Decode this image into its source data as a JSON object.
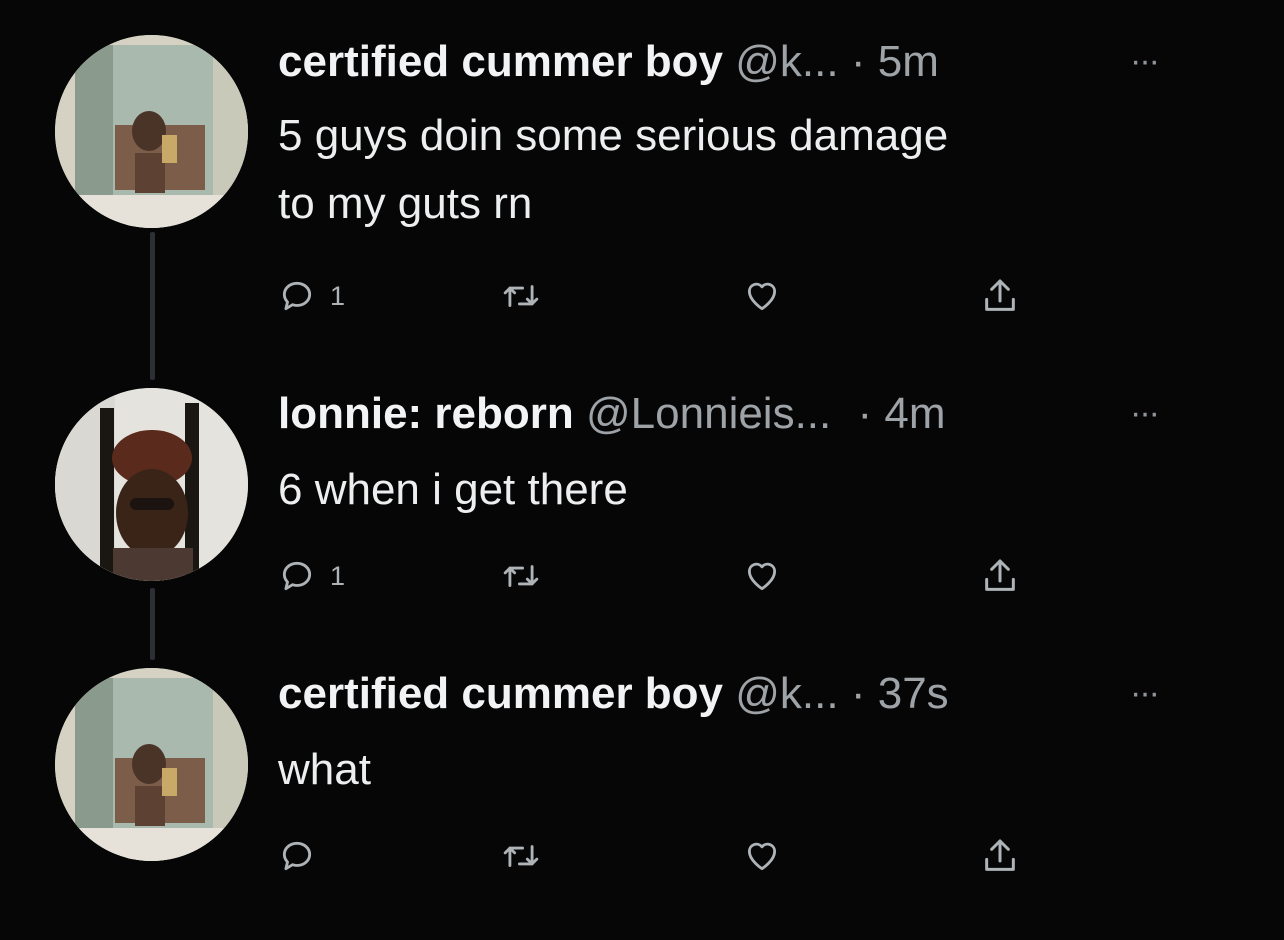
{
  "tweets": [
    {
      "name": "certified cummer boy",
      "handle": "@k...",
      "sep": "·",
      "time": "5m",
      "more": "···",
      "lines": [
        "5 guys doin some serious damage",
        "to my guts rn"
      ],
      "reply_count": "1"
    },
    {
      "name": "lonnie: reborn",
      "handle": "@Lonnieis...",
      "sep": "·",
      "time": "4m",
      "more": "···",
      "lines": [
        "6 when i get there"
      ],
      "reply_count": "1"
    },
    {
      "name": "certified cummer boy",
      "handle": "@k...",
      "sep": "·",
      "time": "37s",
      "more": "···",
      "lines": [
        "what"
      ],
      "reply_count": ""
    }
  ],
  "colors": {
    "background": "#060606",
    "name": "#f2f3f5",
    "secondary": "#9ea3a8",
    "thread_line": "#2c2f33"
  },
  "icons": [
    "reply-icon",
    "retweet-icon",
    "like-icon",
    "share-icon",
    "more-icon"
  ]
}
